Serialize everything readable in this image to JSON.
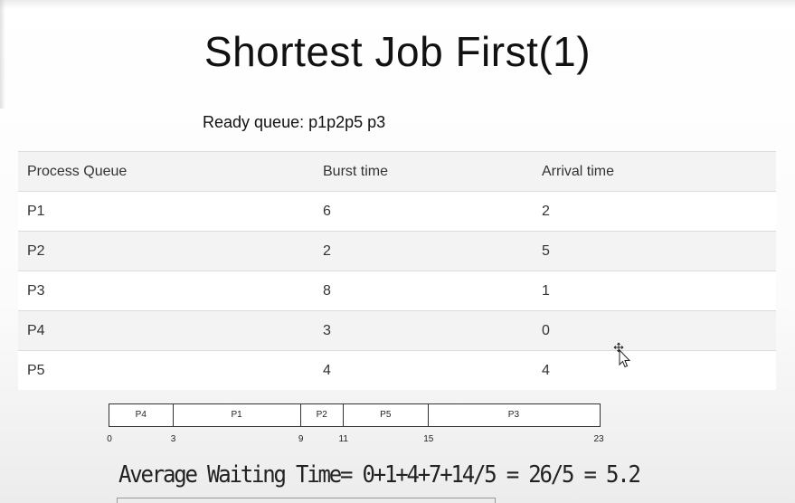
{
  "slide": {
    "title": "Shortest Job First(1)",
    "ready_queue": "Ready queue: p1p2p5 p3"
  },
  "table": {
    "headers": [
      "Process Queue",
      "Burst time",
      "Arrival time"
    ],
    "rows": [
      [
        "P1",
        "6",
        "2"
      ],
      [
        "P2",
        "2",
        "5"
      ],
      [
        "P3",
        "8",
        "1"
      ],
      [
        "P4",
        "3",
        "0"
      ],
      [
        "P5",
        "4",
        "4"
      ]
    ]
  },
  "gantt": {
    "segments": [
      {
        "label": "P4",
        "start": 0,
        "end": 3
      },
      {
        "label": "P1",
        "start": 3,
        "end": 9
      },
      {
        "label": "P2",
        "start": 9,
        "end": 11
      },
      {
        "label": "P5",
        "start": 11,
        "end": 15
      },
      {
        "label": "P3",
        "start": 15,
        "end": 23
      }
    ],
    "ticks": [
      "0",
      "3",
      "9",
      "11",
      "15",
      "23"
    ]
  },
  "average_waiting_time": "Average Waiting Time= 0+1+4+7+14/5 = 26/5 = 5.2",
  "cursor_icon": "move-cursor-icon"
}
